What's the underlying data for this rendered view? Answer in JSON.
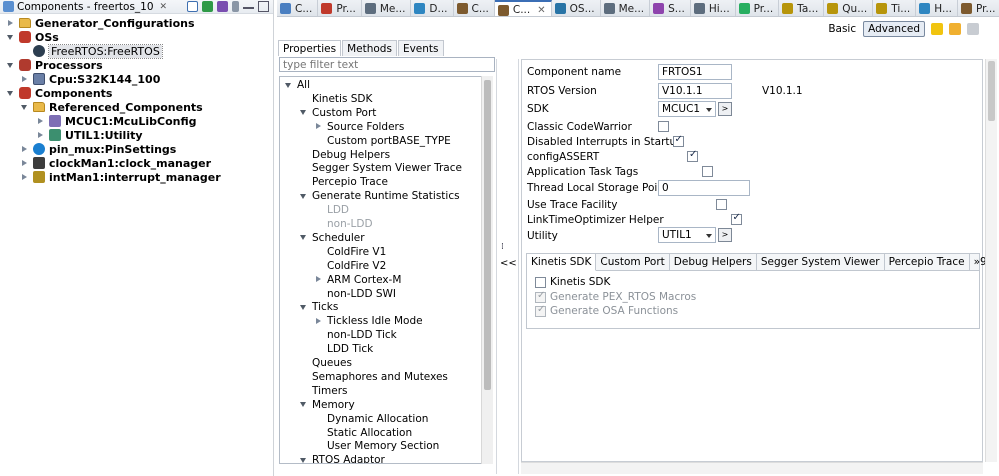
{
  "left_panel": {
    "title": "Components - freertos_10",
    "close": "✕",
    "tree": [
      {
        "label": "Generator_Configurations",
        "bold": true,
        "icon": "folder-icon"
      },
      {
        "label": "OSs",
        "bold": true,
        "icon": "os-folder-icon"
      },
      {
        "label": "FreeRTOS:FreeRTOS",
        "bold": false,
        "icon": "freertos-icon",
        "selected": true
      },
      {
        "label": "Processors",
        "bold": true,
        "icon": "processor-folder-icon"
      },
      {
        "label": "Cpu:S32K144_100",
        "bold": true,
        "icon": "cpu-icon"
      },
      {
        "label": "Components",
        "bold": true,
        "icon": "components-folder-icon"
      },
      {
        "label": "Referenced_Components",
        "bold": true,
        "icon": "folder-icon"
      },
      {
        "label": "MCUC1:McuLibConfig",
        "bold": true,
        "icon": "mcu-icon"
      },
      {
        "label": "UTIL1:Utility",
        "bold": true,
        "icon": "utility-icon"
      },
      {
        "label": "pin_mux:PinSettings",
        "bold": true,
        "icon": "pin-icon"
      },
      {
        "label": "clockMan1:clock_manager",
        "bold": true,
        "icon": "clock-icon"
      },
      {
        "label": "intMan1:interrupt_manager",
        "bold": true,
        "icon": "interrupt-icon"
      }
    ]
  },
  "editor_tabs": [
    {
      "label": "C..."
    },
    {
      "label": "Pr..."
    },
    {
      "label": "Me..."
    },
    {
      "label": "D..."
    },
    {
      "label": "C..."
    },
    {
      "label": "C...",
      "active": true
    },
    {
      "label": "OS..."
    },
    {
      "label": "Me..."
    },
    {
      "label": "S..."
    },
    {
      "label": "Hi..."
    },
    {
      "label": "Pr..."
    },
    {
      "label": "Ta..."
    },
    {
      "label": "Qu..."
    },
    {
      "label": "Ti..."
    },
    {
      "label": "H..."
    },
    {
      "label": "Pr..."
    }
  ],
  "modes": {
    "basic": "Basic",
    "advanced": "Advanced"
  },
  "property_tabs": [
    "Properties",
    "Methods",
    "Events"
  ],
  "filter": {
    "placeholder": "type filter text"
  },
  "category_tree": [
    {
      "label": "All",
      "level": 0,
      "tw": "e"
    },
    {
      "label": "Kinetis SDK",
      "level": 1
    },
    {
      "label": "Custom Port",
      "level": 1,
      "tw": "e"
    },
    {
      "label": "Source Folders",
      "level": 2,
      "tw": "c"
    },
    {
      "label": "Custom portBASE_TYPE",
      "level": 2
    },
    {
      "label": "Debug Helpers",
      "level": 1
    },
    {
      "label": "Segger System Viewer Trace",
      "level": 1
    },
    {
      "label": "Percepio Trace",
      "level": 1
    },
    {
      "label": "Generate Runtime Statistics",
      "level": 1,
      "tw": "e"
    },
    {
      "label": "LDD",
      "level": 2,
      "gray": true
    },
    {
      "label": "non-LDD",
      "level": 2,
      "gray": true
    },
    {
      "label": "Scheduler",
      "level": 1,
      "tw": "e"
    },
    {
      "label": "ColdFire V1",
      "level": 2
    },
    {
      "label": "ColdFire V2",
      "level": 2
    },
    {
      "label": "ARM Cortex-M",
      "level": 2,
      "tw": "c"
    },
    {
      "label": "non-LDD SWI",
      "level": 2
    },
    {
      "label": "Ticks",
      "level": 1,
      "tw": "e"
    },
    {
      "label": "Tickless Idle Mode",
      "level": 2,
      "tw": "c"
    },
    {
      "label": "non-LDD Tick",
      "level": 2
    },
    {
      "label": "LDD Tick",
      "level": 2
    },
    {
      "label": "Queues",
      "level": 1
    },
    {
      "label": "Semaphores and Mutexes",
      "level": 1
    },
    {
      "label": "Timers",
      "level": 1
    },
    {
      "label": "Memory",
      "level": 1,
      "tw": "e"
    },
    {
      "label": "Dynamic Allocation",
      "level": 2
    },
    {
      "label": "Static Allocation",
      "level": 2
    },
    {
      "label": "User Memory Section",
      "level": 2
    },
    {
      "label": "RTOS Adaptor",
      "level": 1,
      "tw": "e"
    }
  ],
  "splitter": {
    "collapse": "<<"
  },
  "properties": {
    "component_name": {
      "label": "Component name",
      "value": "FRTOS1"
    },
    "rtos_version": {
      "label": "RTOS Version",
      "value": "V10.1.1",
      "extra": "V10.1.1"
    },
    "sdk": {
      "label": "SDK",
      "value": "MCUC1"
    },
    "classic_codewarrior": {
      "label": "Classic CodeWarrior",
      "checked": false
    },
    "disabled_interrupts": {
      "label": "Disabled Interrupts in Startup",
      "checked": true
    },
    "config_assert": {
      "label": "configASSERT",
      "checked": true
    },
    "app_task_tags": {
      "label": "Application Task Tags",
      "checked": false
    },
    "thread_local": {
      "label": "Thread Local Storage Pointers",
      "value": "0"
    },
    "trace_facility": {
      "label": "Use Trace Facility",
      "checked": false
    },
    "linktime": {
      "label": "LinkTimeOptimizer Helper",
      "checked": true
    },
    "utility": {
      "label": "Utility",
      "value": "UTIL1"
    }
  },
  "subtabs": {
    "tabs": [
      "Kinetis SDK",
      "Custom Port",
      "Debug Helpers",
      "Segger System Viewer",
      "Percepio Trace",
      "»9"
    ],
    "kinetis_sdk": {
      "label": "Kinetis SDK",
      "checked": false
    },
    "gen_pex": {
      "label": "Generate PEX_RTOS Macros",
      "checked": true
    },
    "gen_osa": {
      "label": "Generate OSA Functions",
      "checked": true
    }
  }
}
